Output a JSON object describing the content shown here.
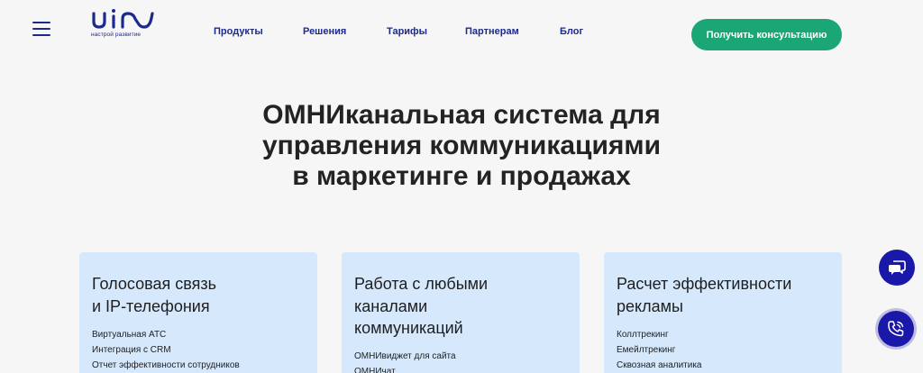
{
  "header": {
    "logo_text": "uis",
    "logo_tagline": "настрой развитие",
    "nav": [
      {
        "label": "Продукты"
      },
      {
        "label": "Решения"
      },
      {
        "label": "Тарифы"
      },
      {
        "label": "Партнерам"
      },
      {
        "label": "Блог"
      }
    ],
    "cta_label": "Получить консультацию"
  },
  "hero": {
    "title_line1": "ОМНИканальная система для",
    "title_line2": "управления коммуникациями",
    "title_line3": "в маркетинге и продажах"
  },
  "cards": [
    {
      "title_line1": "Голосовая связь",
      "title_line2": "и IP-телефония",
      "title_line3": "",
      "items": [
        "Виртуальная АТС",
        "Интеграция с CRM",
        "Отчет эффективности сотрудников"
      ]
    },
    {
      "title_line1": "Работа с любыми",
      "title_line2": "каналами",
      "title_line3": "коммуникаций",
      "items": [
        "ОМНИвиджет для сайта",
        "ОМНИчат"
      ]
    },
    {
      "title_line1": "Расчет эффективности",
      "title_line2": "рекламы",
      "title_line3": "",
      "items": [
        "Коллтрекинг",
        "Емейлтрекинг",
        "Сквозная аналитика"
      ]
    }
  ],
  "icons": {
    "menu": "hamburger-menu-icon",
    "chat": "chat-bubbles-icon",
    "call": "phone-ringing-icon"
  },
  "colors": {
    "brand": "#1b2a8c",
    "cta": "#1aa775",
    "card_bg": "#d6e8fc",
    "fab": "#1a18a8",
    "page_bg": "#f6f6f6"
  }
}
